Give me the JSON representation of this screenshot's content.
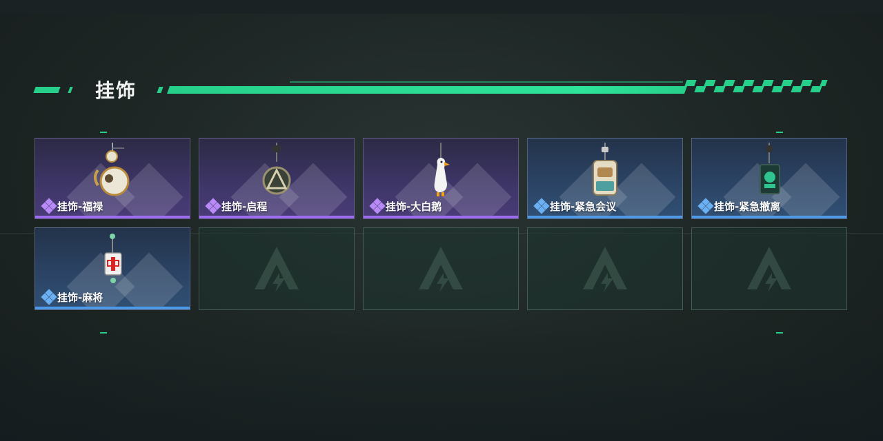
{
  "section": {
    "title": "挂饰"
  },
  "slots": [
    {
      "name": "挂饰-福禄",
      "rarity": "purple",
      "icon": "gourd-charm-icon"
    },
    {
      "name": "挂饰-启程",
      "rarity": "purple",
      "icon": "compass-ring-charm-icon"
    },
    {
      "name": "挂饰-大白鹅",
      "rarity": "purple",
      "icon": "white-goose-charm-icon"
    },
    {
      "name": "挂饰-紧急会议",
      "rarity": "blue",
      "icon": "character-badge-charm-icon"
    },
    {
      "name": "挂饰-紧急撤离",
      "rarity": "blue",
      "icon": "green-emblem-charm-icon"
    },
    {
      "name": "挂饰-麻将",
      "rarity": "blue",
      "icon": "mahjong-tile-charm-icon"
    }
  ],
  "empty_slot_icon": "game-logo-icon",
  "colors": {
    "accent": "#27d08a",
    "purple": "#9c6df0",
    "blue": "#4f9ae6"
  }
}
